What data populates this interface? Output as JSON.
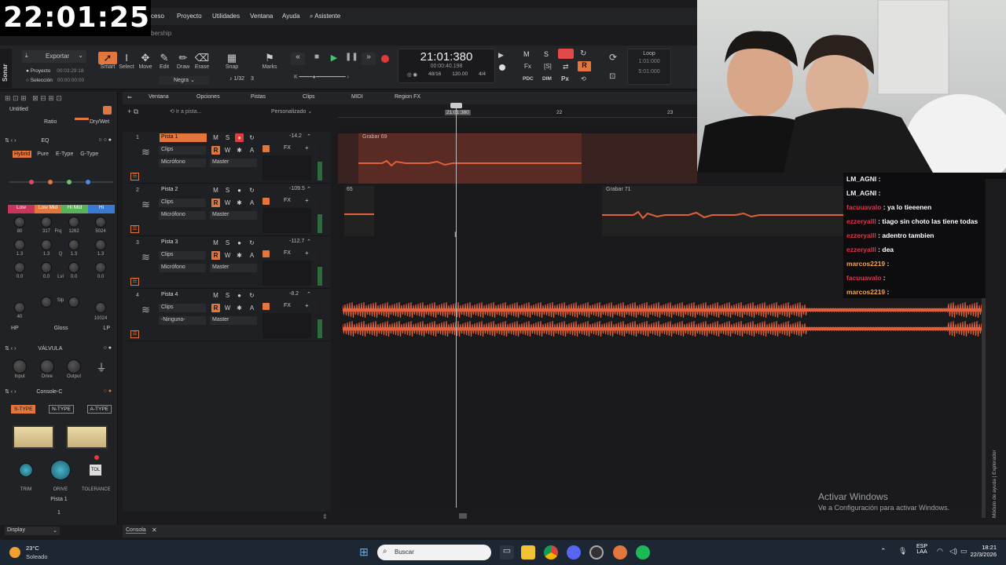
{
  "stream_timer": "22:01:25",
  "menu": {
    "items": [
      "ceso",
      "Proyecto",
      "Utilidades",
      "Ventana",
      "Ayuda",
      "Asistente"
    ],
    "sub": "bership"
  },
  "toolbar": {
    "exportar": "Exportar",
    "proyecto_label": "Proyecto",
    "proyecto_time": "00:03:29:18",
    "seleccion_label": "Selección",
    "seleccion_time": "00:00:00:00",
    "tools": [
      "Smart",
      "Select",
      "Move",
      "Edit",
      "Draw",
      "Erase"
    ],
    "color_select": "Negra",
    "snap": "Snap",
    "snap_value": "1/32",
    "snap_n": "3",
    "marks": "Marks",
    "time_main": "21:01:380",
    "time_sub": "00:00:40.198",
    "tempo_a": "48",
    "tempo_b": "16",
    "bpm": "120.00",
    "meter": "4/4",
    "loop": "Loop",
    "loop_start": "1:01:000",
    "loop_end": "5:01:000",
    "mix_letters": [
      "M",
      "S",
      "R"
    ],
    "pdc": "PDC",
    "dim": "DIM",
    "px": "Px"
  },
  "sonar_label": "Sonar",
  "left_panel": {
    "untitled": "Untitled",
    "ratio": "Ratio",
    "drywet": "Dry/Wet",
    "eq": {
      "title": "EQ",
      "modes": [
        "Hybrid",
        "Pure",
        "E-Type",
        "G-Type"
      ],
      "bands": [
        "Low",
        "Low Mid",
        "Hi Mid",
        "Hi"
      ],
      "freq_values": [
        "80",
        "317",
        "1262",
        "5024"
      ],
      "freq_label": "Frq",
      "q_values": [
        "1.3",
        "1.3",
        "1.3",
        "1.3"
      ],
      "q_label": "Q",
      "lvl_values": [
        "0.0",
        "0.0",
        "0.0",
        "0.0"
      ],
      "lvl_label": "Lvl",
      "slp_label": "Slp",
      "hp_value": "40",
      "lp_value": "10024",
      "filters": [
        "HP",
        "Gloss",
        "LP"
      ]
    },
    "valvula": {
      "title": "VÁLVULA",
      "knobs": [
        "Input",
        "Drive",
        "Output"
      ]
    },
    "console": {
      "title": "Console-C",
      "types": [
        "S-TYPE",
        "N-TYPE",
        "A-TYPE"
      ],
      "knobs": [
        "TRIM",
        "DRIVE",
        "TOLERANCE"
      ],
      "tol": "TOL",
      "track": "Pista 1",
      "num": "1"
    },
    "display": "Display"
  },
  "view_menu": [
    "Ventana",
    "Opciones",
    "Pistas",
    "Clips",
    "MIDI",
    "Region FX"
  ],
  "goto": "Ir a pista...",
  "custom": "Personalizado",
  "ruler": [
    "21:01:380",
    "22",
    "23"
  ],
  "tracks": [
    {
      "num": "1",
      "name": "Pista 1",
      "vol": "-14.2",
      "mode": "Clips",
      "input": "Micrófono",
      "output": "Master",
      "armed": true
    },
    {
      "num": "2",
      "name": "Pista 2",
      "vol": "-109.5",
      "mode": "Clips",
      "input": "Micrófono",
      "output": "Master",
      "armed": false
    },
    {
      "num": "3",
      "name": "Pista 3",
      "vol": "-112.7",
      "mode": "Clips",
      "input": "Micrófono",
      "output": "Master",
      "armed": false
    },
    {
      "num": "4",
      "name": "Pista 4",
      "vol": "-8.2",
      "mode": "Clips",
      "input": "-Ninguno-",
      "output": "Master",
      "armed": false
    }
  ],
  "clips": {
    "c1": "Grabar 69",
    "c2a": "65",
    "c2b": "Grabar 71"
  },
  "chat": [
    {
      "user": "LM_AGNI",
      "msg": "",
      "color": "#f0f0f0"
    },
    {
      "user": "LM_AGNI",
      "msg": "",
      "color": "#f0f0f0"
    },
    {
      "user": "facuuavalo",
      "msg": "ya lo tieeenen",
      "color": "#e0344a"
    },
    {
      "user": "ezzeryalll",
      "msg": "tiago sin choto las tiene todas",
      "color": "#e0344a"
    },
    {
      "user": "ezzeryalll",
      "msg": "adentro tambien",
      "color": "#e0344a"
    },
    {
      "user": "ezzeryalll",
      "msg": "dea",
      "color": "#e0344a"
    },
    {
      "user": "marcos2219",
      "msg": "",
      "color": "#f5a54a"
    },
    {
      "user": "facuuavalo",
      "msg": "",
      "color": "#e0344a"
    },
    {
      "user": "marcos2219",
      "msg": "",
      "color": "#f5a54a"
    }
  ],
  "side_label": "Módulo de ayuda | Explorador",
  "console_tab": "Consola",
  "watermark": {
    "title": "Activar Windows",
    "sub": "Ve a Configuración para activar Windows."
  },
  "taskbar": {
    "temp": "23°C",
    "weather": "Soleado",
    "search": "Buscar",
    "lang": "ESP",
    "lang2": "LAA",
    "time": "18:21",
    "date": "22/3/2026"
  }
}
